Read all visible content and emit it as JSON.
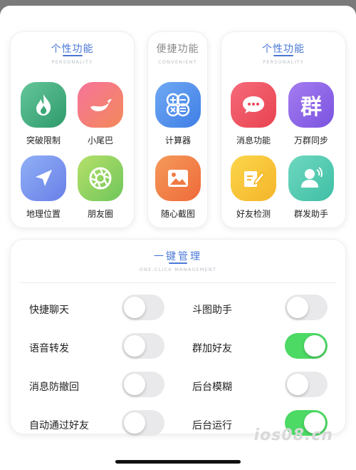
{
  "colors": {
    "blue_title": "#4a78d6",
    "gray_title": "#8a8a8a",
    "toggle_on": "#4cd964",
    "toggle_off": "#e9e9eb"
  },
  "sections": {
    "personality_left": {
      "title": "个性功能",
      "subtitle": "PERSONALITY",
      "items": [
        {
          "label": "突破限制",
          "icon": "flame-icon"
        },
        {
          "label": "小尾巴",
          "icon": "tail-icon"
        },
        {
          "label": "地理位置",
          "icon": "location-arrow-icon"
        },
        {
          "label": "朋友圈",
          "icon": "aperture-icon"
        }
      ]
    },
    "convenient": {
      "title": "便捷功能",
      "subtitle": "CONVENIENT",
      "items": [
        {
          "label": "计算器",
          "icon": "calculator-icon"
        },
        {
          "label": "随心截图",
          "icon": "image-icon"
        }
      ]
    },
    "personality_right": {
      "title": "个性功能",
      "subtitle": "PERSONALITY",
      "items": [
        {
          "label": "消息功能",
          "icon": "chat-bubble-icon"
        },
        {
          "label": "万群同步",
          "icon": "group-text-icon",
          "icon_text": "群"
        },
        {
          "label": "好友检测",
          "icon": "edit-icon"
        },
        {
          "label": "群发助手",
          "icon": "user-broadcast-icon"
        }
      ]
    }
  },
  "one_click": {
    "title": "一键管理",
    "subtitle": "ONE-CLICK MANAGEMENT",
    "left": [
      {
        "label": "快捷聊天",
        "on": false
      },
      {
        "label": "语音转发",
        "on": false
      },
      {
        "label": "消息防撤回",
        "on": false
      },
      {
        "label": "自动通过好友",
        "on": false
      }
    ],
    "right": [
      {
        "label": "斗图助手",
        "on": false
      },
      {
        "label": "群加好友",
        "on": true
      },
      {
        "label": "后台模糊",
        "on": false
      },
      {
        "label": "后台运行",
        "on": true
      }
    ]
  },
  "watermark": "ios08.cn"
}
